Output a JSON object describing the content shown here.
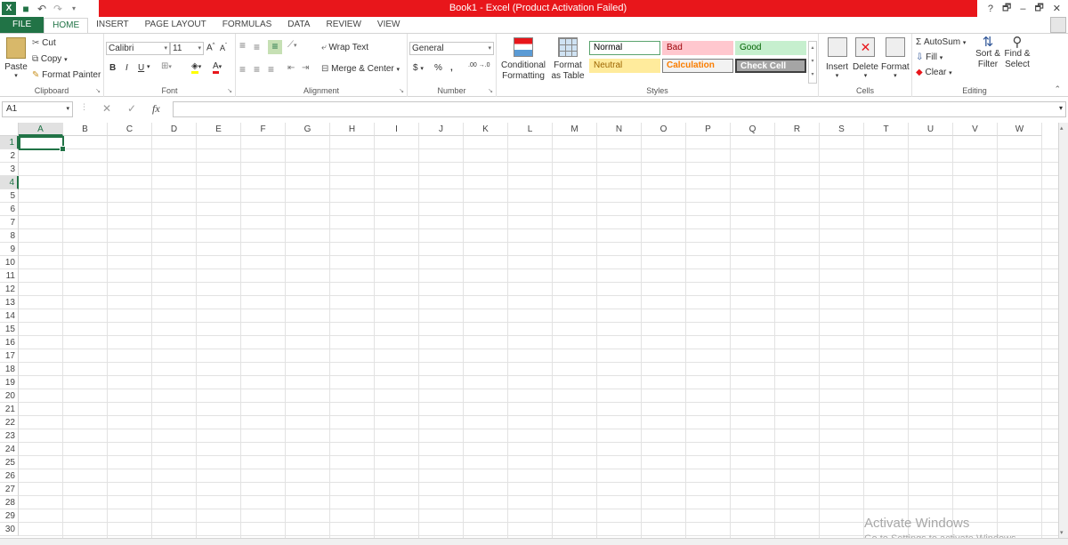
{
  "window": {
    "title": "Book1 -  Excel (Product Activation Failed)",
    "help": "?",
    "restore": "🗗",
    "minimize": "–",
    "maximize": "🗗",
    "close": "✕"
  },
  "tabs": [
    "FILE",
    "HOME",
    "INSERT",
    "PAGE LAYOUT",
    "FORMULAS",
    "DATA",
    "REVIEW",
    "VIEW"
  ],
  "ribbon": {
    "clipboard": {
      "label": "Clipboard",
      "paste": "Paste",
      "cut": "Cut",
      "copy": "Copy",
      "format_painter": "Format Painter"
    },
    "font": {
      "label": "Font",
      "name": "Calibri",
      "size": "11",
      "bold": "B",
      "italic": "I",
      "underline": "U"
    },
    "alignment": {
      "label": "Alignment",
      "wrap": "Wrap Text",
      "merge": "Merge & Center"
    },
    "number": {
      "label": "Number",
      "format": "General",
      "currency": "$",
      "percent": "%",
      "comma": ",",
      "inc_dec": ".00 →.0",
      "dec_dec": "←.0 .00"
    },
    "styles": {
      "label": "Styles",
      "conditional": "Conditional Formatting",
      "format_table": "Format as Table",
      "cells": [
        {
          "name": "Normal",
          "bg": "#ffffff",
          "fg": "#000000",
          "border": "#5aa36d"
        },
        {
          "name": "Bad",
          "bg": "#ffc7ce",
          "fg": "#9c0006",
          "border": "#ffc7ce"
        },
        {
          "name": "Good",
          "bg": "#c6efce",
          "fg": "#006100",
          "border": "#c6efce"
        },
        {
          "name": "Neutral",
          "bg": "#ffeb9c",
          "fg": "#9c6500",
          "border": "#ffeb9c"
        },
        {
          "name": "Calculation",
          "bg": "#f2f2f2",
          "fg": "#fa7d00",
          "border": "#7f7f7f"
        },
        {
          "name": "Check Cell",
          "bg": "#a5a5a5",
          "fg": "#ffffff",
          "border": "#3f3f3f"
        }
      ]
    },
    "cells": {
      "label": "Cells",
      "insert": "Insert",
      "delete": "Delete",
      "format": "Format"
    },
    "editing": {
      "label": "Editing",
      "autosum": "AutoSum",
      "fill": "Fill",
      "clear": "Clear",
      "sort": "Sort & Filter",
      "find": "Find & Select"
    }
  },
  "formula_bar": {
    "name_box": "A1",
    "fx": "fx",
    "cancel": "✕",
    "enter": "✓",
    "formula": ""
  },
  "columns": [
    "A",
    "B",
    "C",
    "D",
    "E",
    "F",
    "G",
    "H",
    "I",
    "J",
    "K",
    "L",
    "M",
    "N",
    "O",
    "P",
    "Q",
    "R",
    "S",
    "T",
    "U",
    "V",
    "W"
  ],
  "rows": [
    "1",
    "2",
    "3",
    "4",
    "5",
    "6",
    "7",
    "8",
    "9",
    "10",
    "11",
    "12",
    "13",
    "14",
    "15",
    "16",
    "17",
    "18",
    "19",
    "20",
    "21",
    "22",
    "23",
    "24",
    "25",
    "26",
    "27",
    "28",
    "29",
    "30"
  ],
  "selected": {
    "col": "A",
    "rows": [
      "1",
      "4"
    ]
  },
  "watermark": {
    "line1": "Activate Windows",
    "line2": "Go to Settings to activate Windows."
  },
  "colors": {
    "accent": "#217346",
    "title_bar": "#e8161b"
  }
}
